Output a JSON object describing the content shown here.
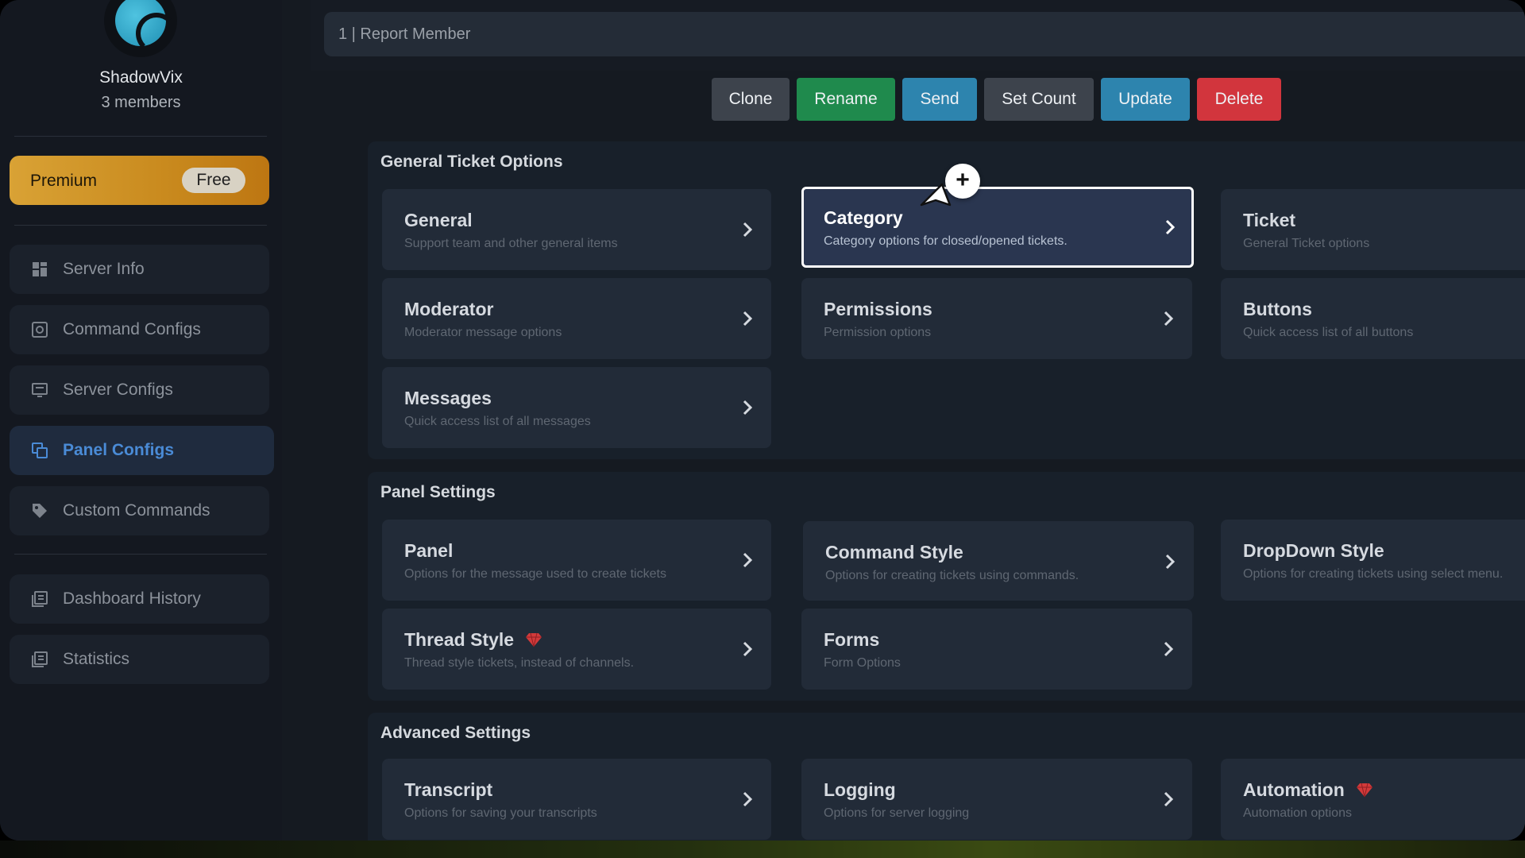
{
  "server": {
    "name": "ShadowVix",
    "members": "3 members"
  },
  "premium": {
    "label": "Premium",
    "badge": "Free"
  },
  "nav": {
    "items": [
      {
        "label": "Server Info",
        "icon": "grid-icon"
      },
      {
        "label": "Command Configs",
        "icon": "gear-box-icon"
      },
      {
        "label": "Server Configs",
        "icon": "monitor-icon"
      },
      {
        "label": "Panel Configs",
        "icon": "layers-icon",
        "active": true
      },
      {
        "label": "Custom Commands",
        "icon": "tag-icon"
      },
      {
        "label": "Dashboard History",
        "icon": "history-icon"
      },
      {
        "label": "Statistics",
        "icon": "stats-icon"
      }
    ]
  },
  "panel_name": {
    "value": "1 | Report Member"
  },
  "toolbar": {
    "clone": "Clone",
    "rename": "Rename",
    "send": "Send",
    "set_count": "Set Count",
    "update": "Update",
    "delete": "Delete"
  },
  "colors": {
    "clone": "#3d434c",
    "rename": "#1f8a4d",
    "send": "#2d84ae",
    "set_count": "#3d434c",
    "update": "#2d84ae",
    "delete": "#d2353d",
    "premium": "#d9a235",
    "active_nav": "#4a8bd6",
    "gem": "#d23a3a"
  },
  "sections": {
    "general": {
      "title": "General Ticket Options",
      "cards": [
        {
          "title": "General",
          "desc": "Support team and other general items"
        },
        {
          "title": "Category",
          "desc": "Category options for closed/opened tickets.",
          "highlighted": true
        },
        {
          "title": "Ticket",
          "desc": "General Ticket options"
        },
        {
          "title": "Moderator",
          "desc": "Moderator message options"
        },
        {
          "title": "Permissions",
          "desc": "Permission options"
        },
        {
          "title": "Buttons",
          "desc": "Quick access list of all buttons"
        },
        {
          "title": "Messages",
          "desc": "Quick access list of all messages"
        }
      ]
    },
    "panel": {
      "title": "Panel Settings",
      "cards": [
        {
          "title": "Panel",
          "desc": "Options for the message used to create tickets"
        },
        {
          "title": "Command Style",
          "desc": "Options for creating tickets using commands."
        },
        {
          "title": "DropDown Style",
          "desc": "Options for creating tickets using select menu."
        },
        {
          "title": "Thread Style",
          "desc": "Thread style tickets, instead of channels.",
          "premium_icon": "gem-icon"
        },
        {
          "title": "Forms",
          "desc": "Form Options"
        }
      ]
    },
    "advanced": {
      "title": "Advanced Settings",
      "cards": [
        {
          "title": "Transcript",
          "desc": "Options for saving your transcripts"
        },
        {
          "title": "Logging",
          "desc": "Options for server logging"
        },
        {
          "title": "Automation",
          "desc": "Automation options",
          "premium_icon": "gem-icon"
        }
      ]
    }
  },
  "cursor": {
    "badge": "+"
  }
}
